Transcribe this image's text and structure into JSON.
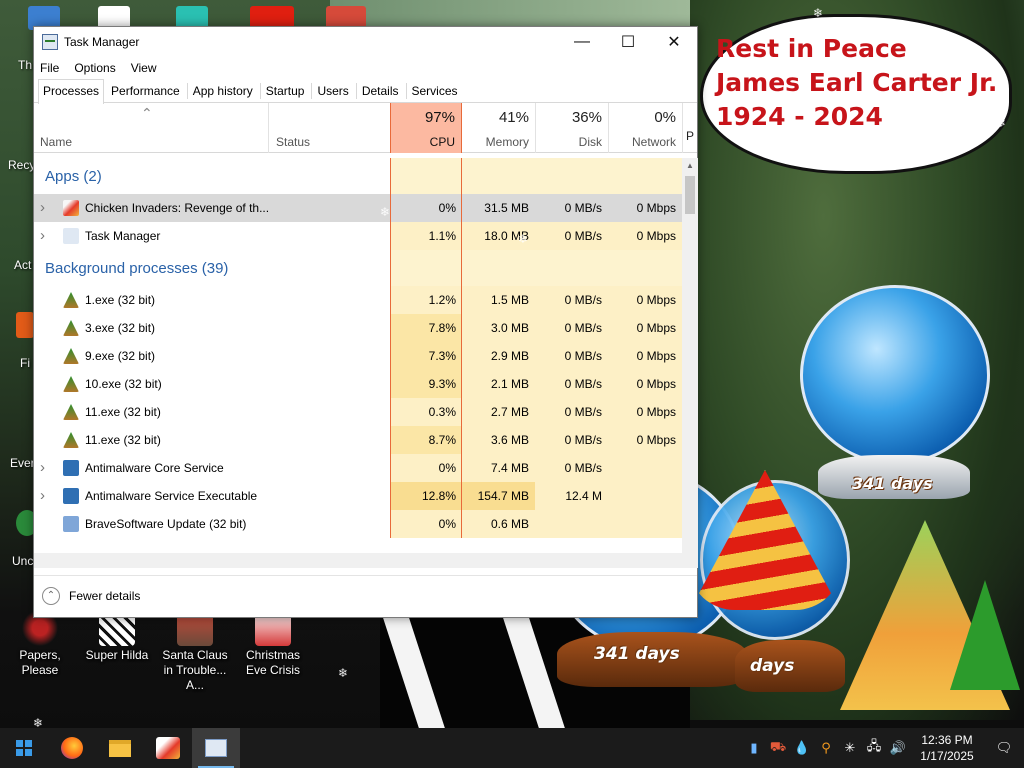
{
  "desktop": {
    "left_labels": [
      "Th",
      "Recy",
      "Act",
      "Fi",
      "Ever",
      "Unc"
    ],
    "icons": [
      {
        "label": "Papers, Please",
        "icon": "papers-please-icon"
      },
      {
        "label": "Super Hilda",
        "icon": "super-hilda-icon"
      },
      {
        "label": "Santa Claus in Trouble... A...",
        "icon": "santa-claus-icon"
      },
      {
        "label": "Christmas Eve Crisis",
        "icon": "christmas-eve-icon"
      }
    ],
    "memorial": {
      "line1": "Rest in Peace",
      "line2": "James Earl Carter Jr.",
      "line3": "1924 - 2024",
      "color": "#c7141a"
    },
    "globe_days": [
      "341 days",
      "341 days",
      "days"
    ]
  },
  "taskmanager": {
    "title": "Task Manager",
    "window_buttons": {
      "minimize": "—",
      "maximize": "☐",
      "close": "✕"
    },
    "menu": [
      "File",
      "Options",
      "View"
    ],
    "tabs": [
      "Processes",
      "Performance",
      "App history",
      "Startup",
      "Users",
      "Details",
      "Services"
    ],
    "active_tab": "Processes",
    "columns": {
      "name": "Name",
      "status": "Status",
      "cpu": {
        "pct": "97%",
        "label": "CPU"
      },
      "memory": {
        "pct": "41%",
        "label": "Memory"
      },
      "disk": {
        "pct": "36%",
        "label": "Disk"
      },
      "network": {
        "pct": "0%",
        "label": "Network"
      },
      "power_cut": "P"
    },
    "groups": {
      "apps": "Apps (2)",
      "background": "Background processes (39)"
    },
    "apps": [
      {
        "name": "Chicken Invaders: Revenge of th...",
        "cpu": "0%",
        "mem": "31.5 MB",
        "disk": "0 MB/s",
        "net": "0 Mbps",
        "expandable": true,
        "selected": true,
        "icon": "chicken-invaders-icon"
      },
      {
        "name": "Task Manager",
        "cpu": "1.1%",
        "mem": "18.0 MB",
        "disk": "0 MB/s",
        "net": "0 Mbps",
        "expandable": true,
        "selected": false,
        "icon": "task-manager-icon"
      }
    ],
    "background": [
      {
        "name": "1.exe (32 bit)",
        "cpu": "1.2%",
        "mem": "1.5 MB",
        "disk": "0 MB/s",
        "net": "0 Mbps",
        "expandable": false,
        "icon": "tree-exe-icon"
      },
      {
        "name": "3.exe (32 bit)",
        "cpu": "7.8%",
        "mem": "3.0 MB",
        "disk": "0 MB/s",
        "net": "0 Mbps",
        "expandable": false,
        "icon": "tree-exe-icon"
      },
      {
        "name": "9.exe (32 bit)",
        "cpu": "7.3%",
        "mem": "2.9 MB",
        "disk": "0 MB/s",
        "net": "0 Mbps",
        "expandable": false,
        "icon": "tree-exe-icon"
      },
      {
        "name": "10.exe (32 bit)",
        "cpu": "9.3%",
        "mem": "2.1 MB",
        "disk": "0 MB/s",
        "net": "0 Mbps",
        "expandable": false,
        "icon": "tree-exe-icon"
      },
      {
        "name": "11.exe (32 bit)",
        "cpu": "0.3%",
        "mem": "2.7 MB",
        "disk": "0 MB/s",
        "net": "0 Mbps",
        "expandable": false,
        "icon": "tree-exe-icon"
      },
      {
        "name": "11.exe (32 bit)",
        "cpu": "8.7%",
        "mem": "3.6 MB",
        "disk": "0 MB/s",
        "net": "0 Mbps",
        "expandable": false,
        "icon": "tree-exe-icon"
      },
      {
        "name": "Antimalware Core Service",
        "cpu": "0%",
        "mem": "7.4 MB",
        "disk": "0 MB/s",
        "net": "",
        "expandable": true,
        "icon": "service-window-icon"
      },
      {
        "name": "Antimalware Service Executable",
        "cpu": "12.8%",
        "mem": "154.7 MB",
        "disk": "12.4 M",
        "net": "",
        "expandable": true,
        "icon": "service-window-icon"
      },
      {
        "name": "BraveSoftware Update (32 bit)",
        "cpu": "0%",
        "mem": "0.6 MB",
        "disk": "",
        "net": "",
        "expandable": false,
        "icon": "update-icon"
      }
    ],
    "footer": "Fewer details"
  },
  "taskbar": {
    "apps": [
      "start-icon",
      "firefox-icon",
      "file-explorer-icon",
      "chicken-invaders-icon",
      "task-manager-icon"
    ],
    "clock": {
      "time": "12:36 PM",
      "date": "1/17/2025"
    }
  }
}
